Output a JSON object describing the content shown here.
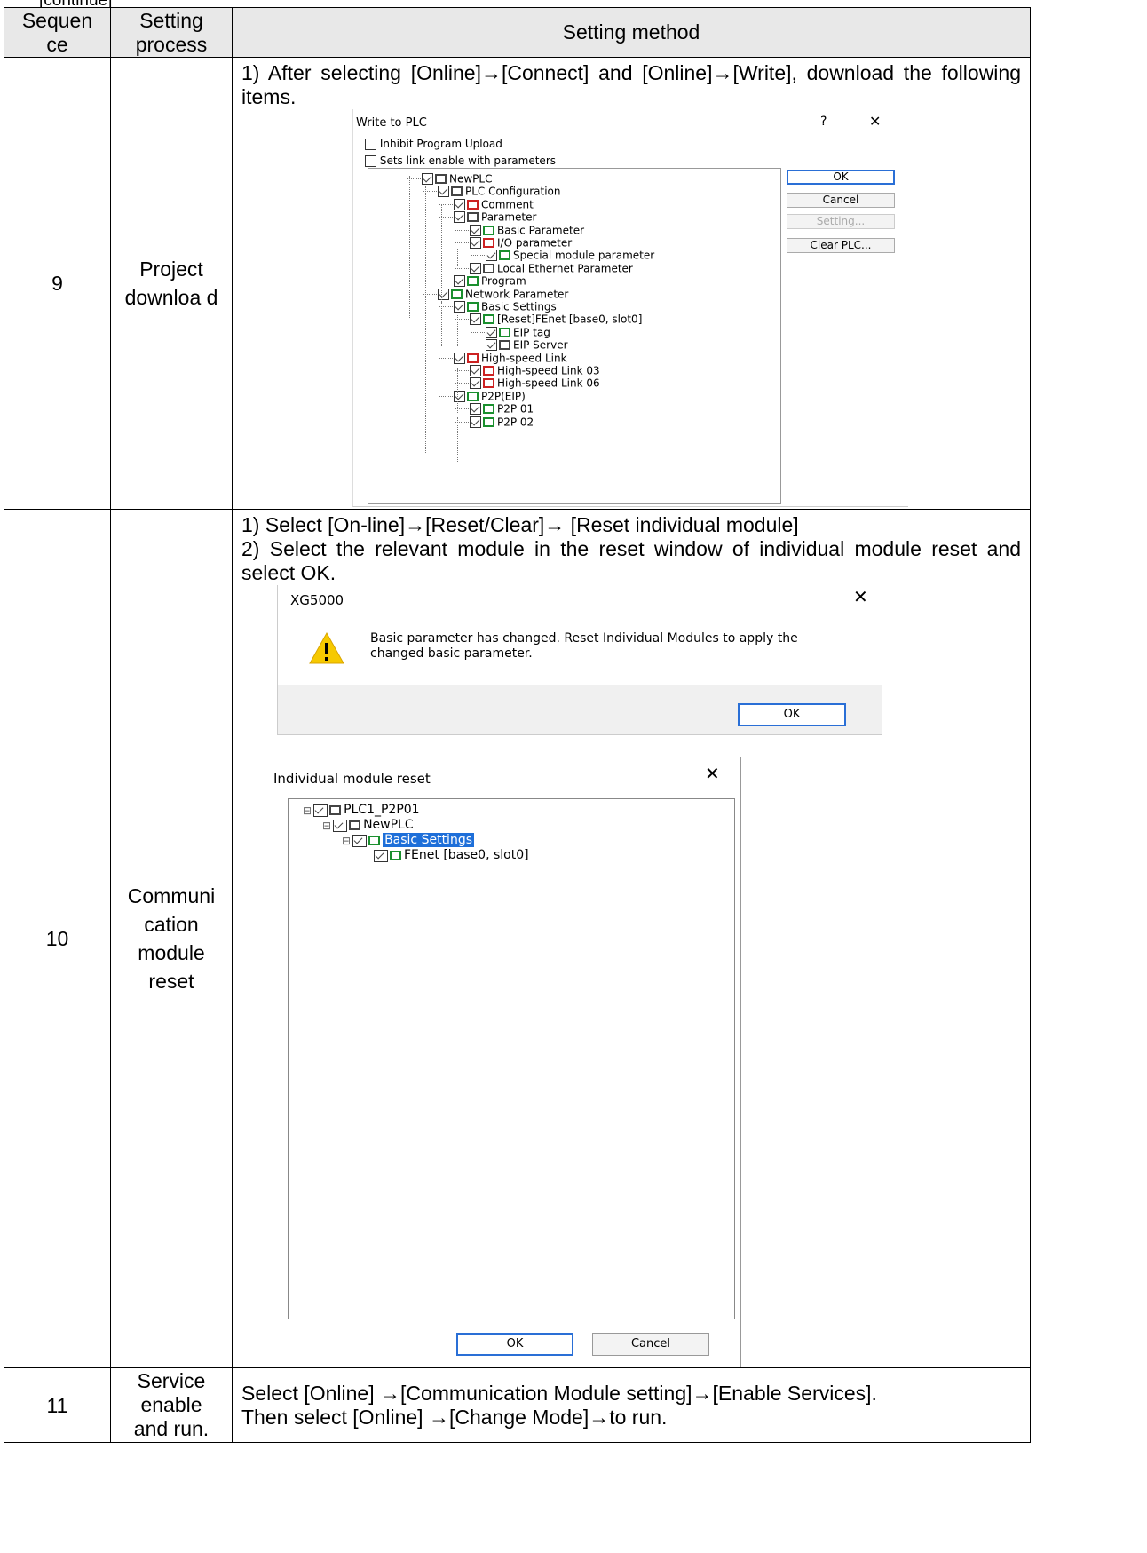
{
  "continued": "[continue]",
  "headers": {
    "sequence": "Sequen ce",
    "process": "Setting process",
    "method": "Setting method"
  },
  "rows": [
    {
      "seq": "9",
      "process": "Project downloa d",
      "text": "1) After selecting [Online]→[Connect] and [Online]→[Write], download the following items.",
      "dialog": {
        "title": "Write to PLC",
        "help": "?",
        "close": "✕",
        "options": [
          "Inhibit Program Upload",
          "Sets link enable with parameters"
        ],
        "tree": [
          "NewPLC",
          "PLC Configuration",
          "Comment",
          "Parameter",
          "Basic Parameter",
          "I/O parameter",
          "Special module parameter",
          "Local Ethernet Parameter",
          "Program",
          "Network Parameter",
          "Basic Settings",
          "[Reset]FEnet [base0, slot0]",
          "EIP tag",
          "EIP Server",
          "High-speed Link",
          "High-speed Link 03",
          "High-speed Link 06",
          "P2P(EIP)",
          "P2P 01",
          "P2P 02"
        ],
        "buttons": {
          "ok": "OK",
          "cancel": "Cancel",
          "setting": "Setting...",
          "clear": "Clear PLC..."
        }
      }
    },
    {
      "seq": "10",
      "process": "Communi cation module reset",
      "text1": "1) Select [On-line]→[Reset/Clear]→ [Reset individual module]",
      "text2": "2) Select the relevant module in the reset window of individual module reset and select OK.",
      "msgbox": {
        "title": "XG5000",
        "close": "✕",
        "message": "Basic parameter has changed. Reset Individual Modules to apply the changed basic parameter.",
        "ok": "OK"
      },
      "reset": {
        "title": "Individual module reset",
        "close": "✕",
        "tree": [
          "PLC1_P2P01",
          "NewPLC",
          "Basic Settings",
          "FEnet [base0, slot0]"
        ],
        "ok": "OK",
        "cancel": "Cancel"
      }
    },
    {
      "seq": "11",
      "process": "Service enable and run.",
      "line1": "Select [Online] →[Communication Module setting]→[Enable Services].",
      "line2": "Then select [Online] →[Change Mode]→to run."
    }
  ]
}
